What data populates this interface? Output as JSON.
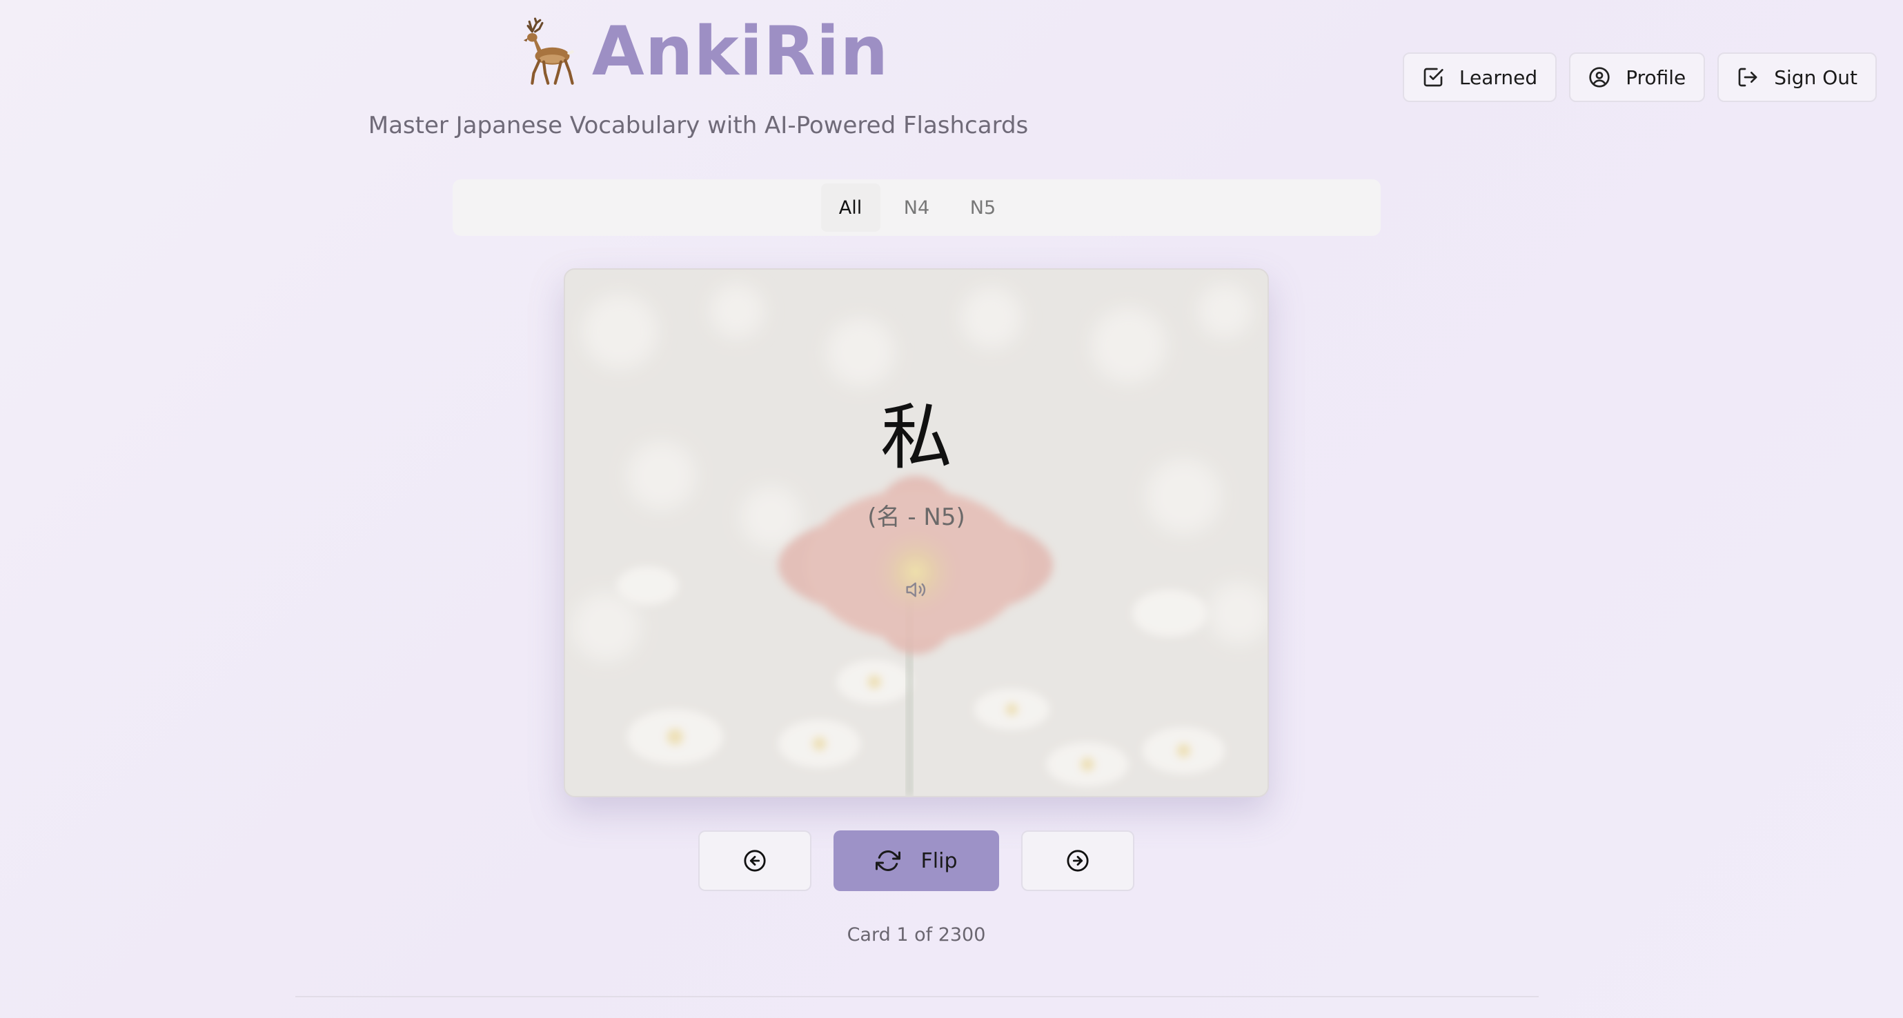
{
  "header": {
    "title": "AnkiRin",
    "subtitle": "Master Japanese Vocabulary with AI-Powered Flashcards",
    "logo_icon": "deer-icon"
  },
  "actions": {
    "learned_label": "Learned",
    "profile_label": "Profile",
    "signout_label": "Sign Out"
  },
  "filters": {
    "tabs": [
      {
        "label": "All",
        "active": true
      },
      {
        "label": "N4",
        "active": false
      },
      {
        "label": "N5",
        "active": false
      }
    ]
  },
  "card": {
    "word": "私",
    "meta": "(名 - N5)",
    "audio_icon": "speaker-icon",
    "background": "flower-photo"
  },
  "controls": {
    "flip_label": "Flip",
    "prev_icon": "arrow-left-circle-icon",
    "next_icon": "arrow-right-circle-icon"
  },
  "progress": {
    "counter_text": "Card 1 of 2300",
    "current": 1,
    "total": 2300
  },
  "colors": {
    "accent": "#9d8fc4",
    "flip_button": "#9d92c7",
    "background": "#f1ecf8"
  }
}
